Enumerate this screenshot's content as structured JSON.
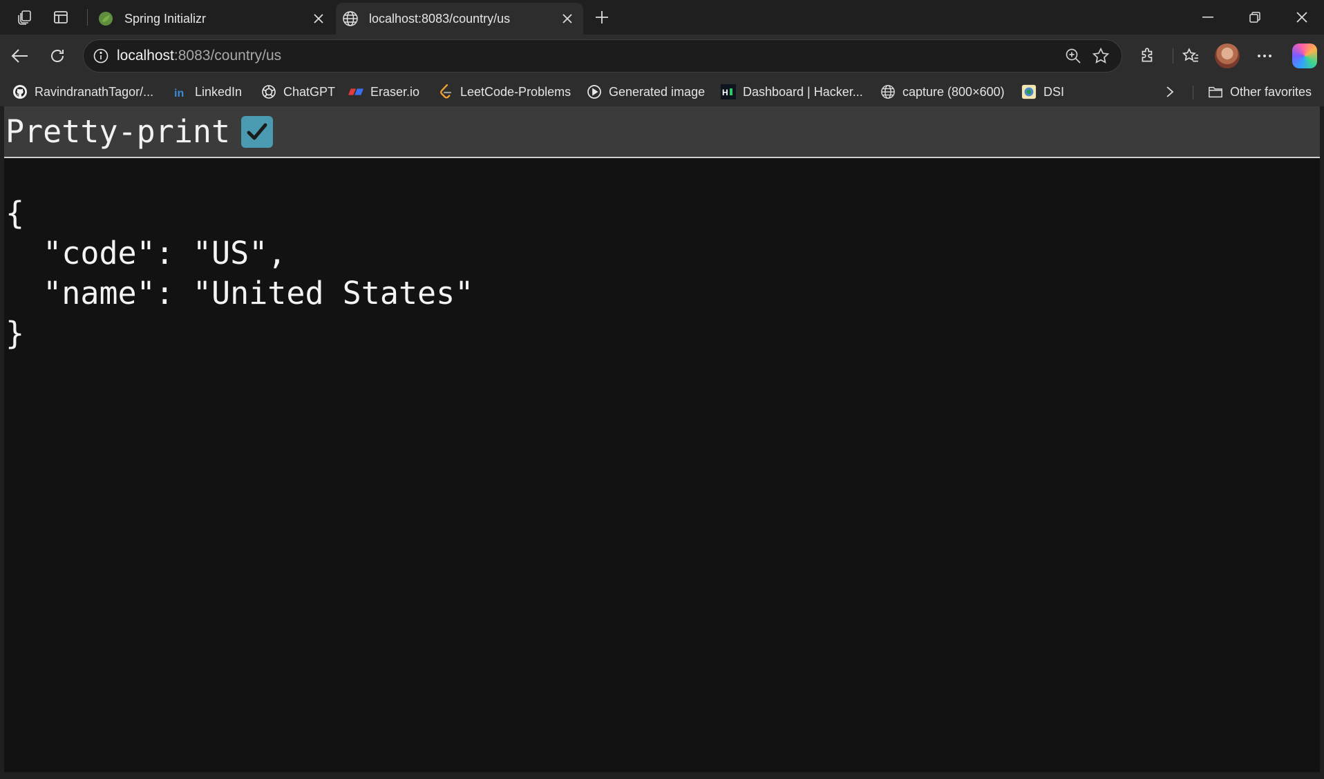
{
  "browser": {
    "tabs": [
      {
        "title": "Spring Initializr",
        "icon": "spring-leaf-icon",
        "active": false
      },
      {
        "title": "localhost:8083/country/us",
        "icon": "globe-icon",
        "active": true
      }
    ],
    "address": {
      "host": "localhost",
      "rest": ":8083/country/us"
    },
    "favorites": [
      {
        "label": "RavindranathTagor/...",
        "icon": "github-icon"
      },
      {
        "label": "LinkedIn",
        "icon": "linkedin-icon"
      },
      {
        "label": "ChatGPT",
        "icon": "chatgpt-icon"
      },
      {
        "label": "Eraser.io",
        "icon": "eraser-icon"
      },
      {
        "label": "LeetCode-Problems",
        "icon": "leetcode-icon"
      },
      {
        "label": "Generated image",
        "icon": "play-circle-icon"
      },
      {
        "label": "Dashboard | Hacker...",
        "icon": "hackerrank-icon"
      },
      {
        "label": "capture (800×600)",
        "icon": "globe-icon"
      },
      {
        "label": "DSI",
        "icon": "dsi-icon"
      }
    ],
    "other_favorites": "Other favorites"
  },
  "page": {
    "pretty_print_label": "Pretty-print",
    "pretty_print_checked": true,
    "json_lines": [
      "{",
      "  \"code\": \"US\",",
      "  \"name\": \"United States\"",
      "}"
    ]
  },
  "colors": {
    "checkbox": "#4a9bb2",
    "page_bg": "#121212",
    "toolbar_bg": "#2d2d2d"
  }
}
